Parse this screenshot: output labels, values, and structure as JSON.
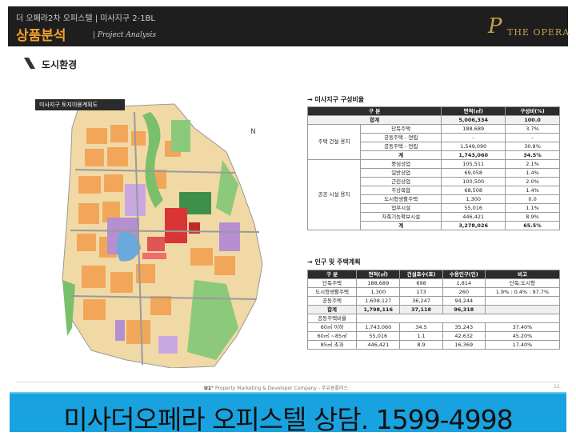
{
  "header": {
    "subtitle": "더 오페라2차 오피스텔 | 미사지구 2-1BL",
    "title": "상품분석",
    "title_en": "| Project Analysis",
    "logo_mark": "P",
    "logo_text": "THE OPERA"
  },
  "section": {
    "title": "도시환경"
  },
  "map": {
    "label": "미사지구 토지이용계획도",
    "compass": "N"
  },
  "table1": {
    "caption": "→ 미사지구 구성비율",
    "headers": [
      "구     분",
      "면적(㎡)",
      "구성비(%)"
    ],
    "total": {
      "label": "합계",
      "area": "5,006,334",
      "ratio": "100.0"
    },
    "housing_group": "주택 건설 용지",
    "housing_rows": [
      {
        "name": "단독주택",
        "area": "188,689",
        "ratio": "3.7%"
      },
      {
        "name": "공동주택 - 연립",
        "area": "-",
        "ratio": "-"
      },
      {
        "name": "공동주택 - 연립",
        "area": "1,549,090",
        "ratio": "30.8%"
      },
      {
        "name": "계",
        "area": "1,743,060",
        "ratio": "34.5%"
      }
    ],
    "public_group": "공공 시설 용지",
    "public_rows": [
      {
        "name": "중심상업",
        "area": "105,511",
        "ratio": "2.1%"
      },
      {
        "name": "일반상업",
        "area": "69,058",
        "ratio": "1.4%"
      },
      {
        "name": "근린상업",
        "area": "100,500",
        "ratio": "2.0%"
      },
      {
        "name": "주상복합",
        "area": "68,508",
        "ratio": "1.4%"
      },
      {
        "name": "도시형생활주택",
        "area": "1,300",
        "ratio": "0.0"
      },
      {
        "name": "업무시설",
        "area": "55,016",
        "ratio": "1.1%"
      },
      {
        "name": "자족기능확보시설",
        "area": "446,421",
        "ratio": "8.9%"
      },
      {
        "name": "계",
        "area": "3,278,026",
        "ratio": "65.5%"
      }
    ]
  },
  "table2": {
    "caption": "→ 인구 및 주택계획",
    "headers": [
      "구     분",
      "면적(㎡)",
      "건설호수(호)",
      "수용인구(인)",
      "비고"
    ],
    "rows": [
      {
        "c1": "단독주택",
        "c2": "188,689",
        "c3": "698",
        "c4": "1,814",
        "c5": "단독:도시형"
      },
      {
        "c1": "도시형생활주택",
        "c2": "1,300",
        "c3": "173",
        "c4": "260",
        "c5": "1.9% : 0.4% : 97.7%"
      },
      {
        "c1": "공동주택",
        "c2": "1,608,127",
        "c3": "36,247",
        "c4": "94,244",
        "c5": ""
      },
      {
        "c1": "합계",
        "c2": "1,798,116",
        "c3": "37,118",
        "c4": "96,318",
        "c5": ""
      }
    ],
    "ratio_label": "공동주택비율",
    "ratio_rows": [
      {
        "c1": "60㎡ 이하",
        "c2": "1,743,060",
        "c3": "34.5",
        "c4": "35,243",
        "c5": "37.40%"
      },
      {
        "c1": "60㎡ ~85㎡",
        "c2": "55,016",
        "c3": "1.1",
        "c4": "42,632",
        "c5": "45.20%"
      },
      {
        "c1": "85㎡ 초과",
        "c2": "446,421",
        "c3": "8.9",
        "c4": "16,369",
        "c5": "17.40%"
      }
    ]
  },
  "footer": {
    "brand": "U1°",
    "text": "Property Marketing & Developer Company - 주유원플러스",
    "page": "12"
  },
  "banner": {
    "text": "미사더오페라 오피스텔 상담. 1599-4998"
  },
  "colors": {
    "header_bg": "#1e1e1e",
    "title_orange": "#f2a12f",
    "logo_gold": "#c7a24c",
    "banner_blue": "#19a2e0",
    "table_header": "#2c2c2c"
  }
}
